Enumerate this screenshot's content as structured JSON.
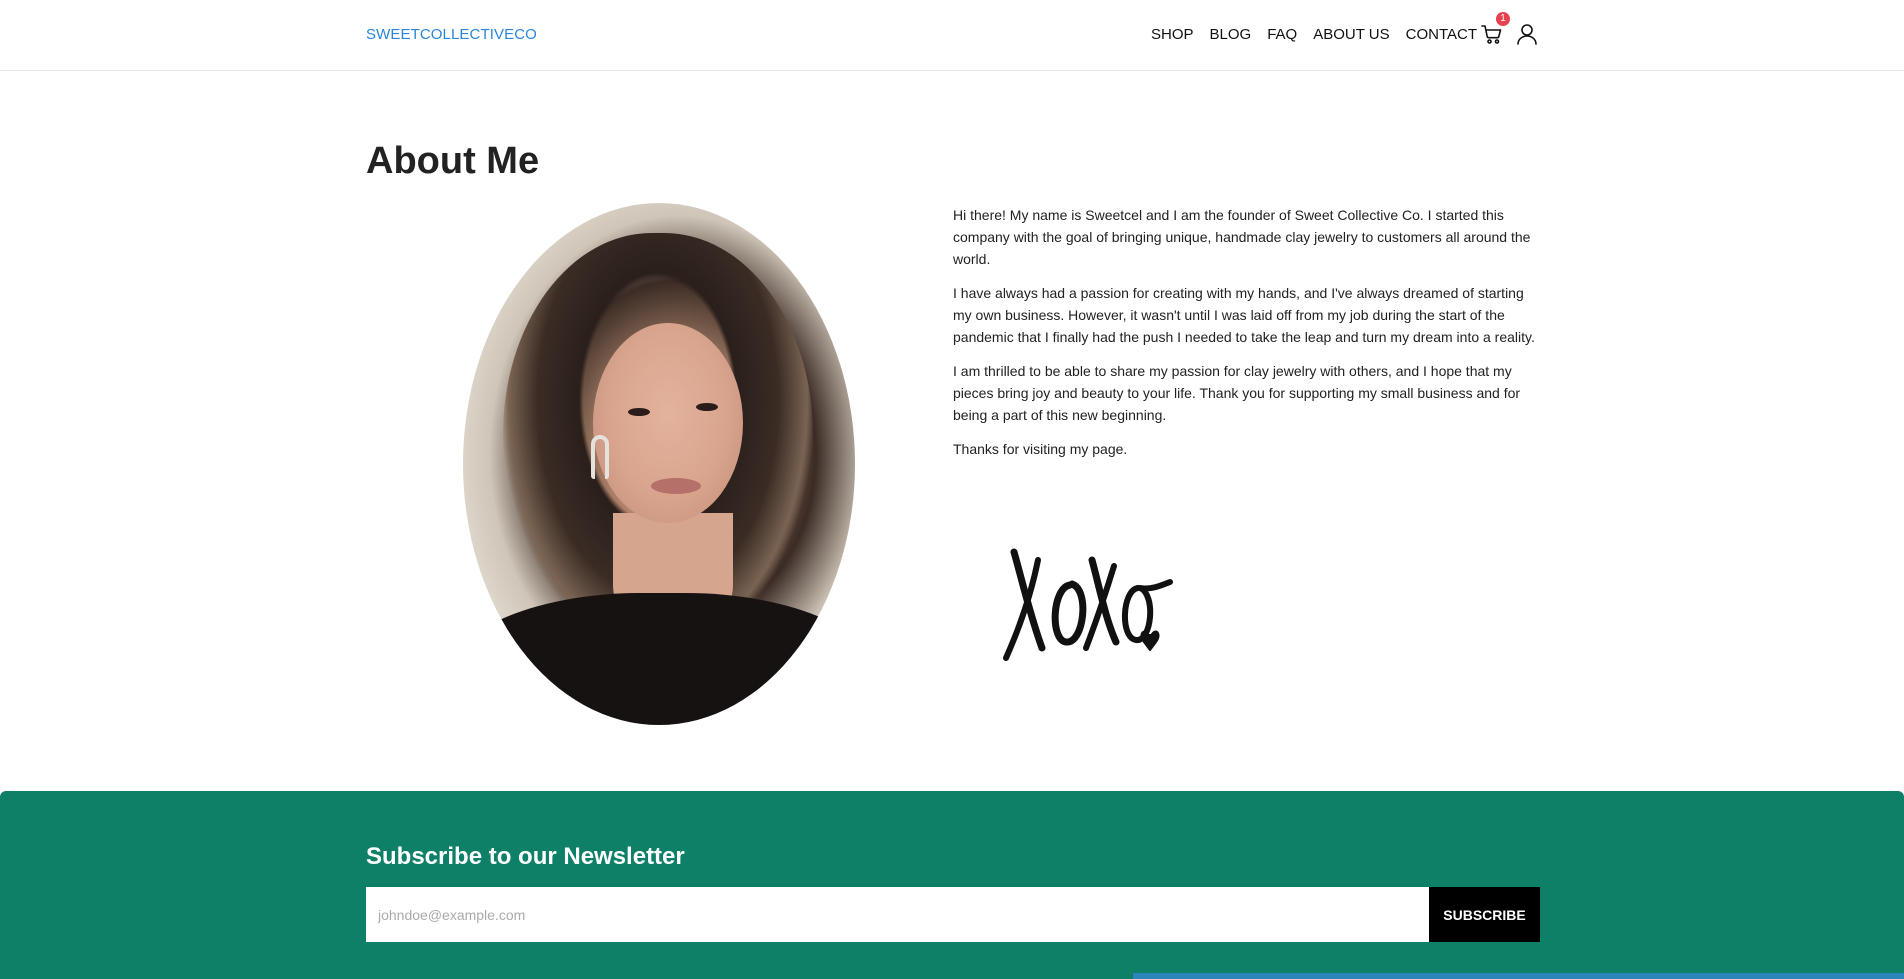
{
  "header": {
    "brand": "SWEETCOLLECTIVECO",
    "nav": [
      "SHOP",
      "BLOG",
      "FAQ",
      "ABOUT US",
      "CONTACT"
    ],
    "cart_count": "1",
    "icons": {
      "cart": "cart-icon",
      "account": "user-icon"
    },
    "brand_color": "#2a86d8",
    "badge_color": "#e8414f"
  },
  "main": {
    "title": "About Me",
    "portrait_alt": "Portrait of the founder",
    "paragraphs": [
      "Hi there! My name is Sweetcel and I am the founder of Sweet Collective Co. I started this company with the goal of bringing unique, handmade clay jewelry to customers all around the world.",
      "I have always had a passion for creating with my hands, and I've always dreamed of starting my own business. However, it wasn't until I was laid off from my job during the start of the pandemic that I finally had the push I needed to take the leap and turn my dream into a reality.",
      "I am thrilled to be able to share my passion for clay jewelry with others, and I hope that my pieces bring joy and beauty to your life. Thank you for supporting my small business and for being a part of this new beginning.",
      "Thanks for visiting my page."
    ],
    "signature": "xoxo"
  },
  "newsletter": {
    "title": "Subscribe to our Newsletter",
    "placeholder": "johndoe@example.com",
    "value": "",
    "button": "SUBSCRIBE",
    "background": "#0e8068"
  }
}
